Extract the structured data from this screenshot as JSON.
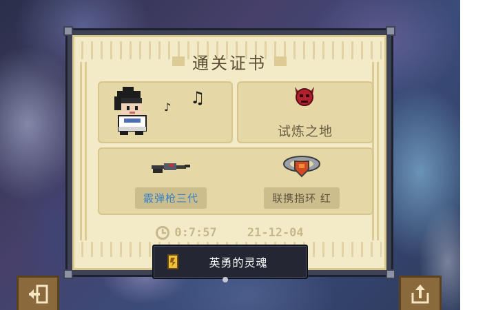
{
  "certificate": {
    "title": "通关证书",
    "stage": {
      "name": "试炼之地",
      "icon": "demon-skull-icon"
    },
    "hero": {
      "icon": "knight-hero-sprite",
      "notes": [
        "♪",
        "♫"
      ]
    },
    "items": [
      {
        "name": "霰弹枪三代",
        "icon": "shotgun-icon",
        "color": "#3b83c4"
      },
      {
        "name": "联携指环 红",
        "icon": "red-ring-icon",
        "color": "#5d5440"
      }
    ],
    "time": "0:7:57",
    "date": "21-12-04"
  },
  "soul": {
    "label": "英勇的灵魂",
    "icon": "soul-card-icon"
  },
  "buttons": {
    "exit_icon": "exit-icon",
    "share_icon": "share-icon"
  },
  "colors": {
    "frame": "#3d4254",
    "paper": "#f3ebc8",
    "card": "#e5d7a6",
    "button": "#8a6a3d"
  }
}
